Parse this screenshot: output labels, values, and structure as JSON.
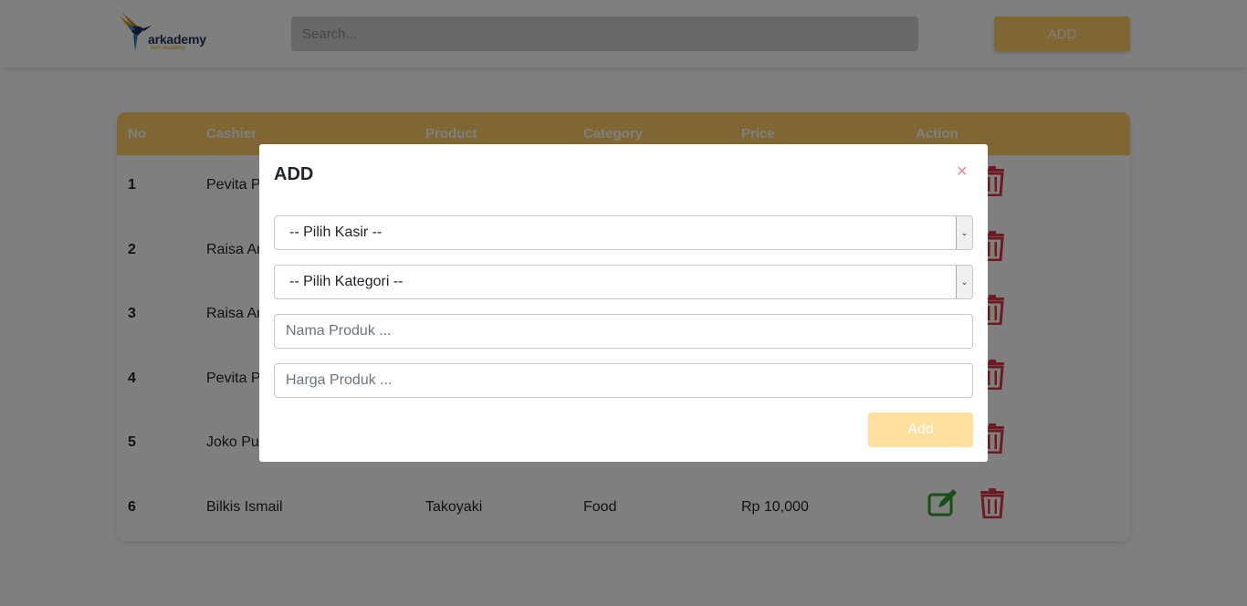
{
  "header": {
    "logo_text": "arkademy",
    "logo_subtext": "Tech Academy",
    "search_placeholder": "Search...",
    "add_label": "ADD"
  },
  "table": {
    "columns": [
      "No",
      "Cashier",
      "Product",
      "Category",
      "Price",
      "Action"
    ],
    "rows": [
      {
        "no": "1",
        "cashier": "Pevita Pe",
        "product": "",
        "category": "",
        "price": ""
      },
      {
        "no": "2",
        "cashier": "Raisa An",
        "product": "",
        "category": "",
        "price": ""
      },
      {
        "no": "3",
        "cashier": "Raisa An",
        "product": "",
        "category": "",
        "price": ""
      },
      {
        "no": "4",
        "cashier": "Pevita Pe",
        "product": "",
        "category": "",
        "price": ""
      },
      {
        "no": "5",
        "cashier": "Joko Pur",
        "product": "",
        "category": "",
        "price": ""
      },
      {
        "no": "6",
        "cashier": "Bilkis Ismail",
        "product": "Takoyaki",
        "category": "Food",
        "price": "Rp 10,000"
      }
    ]
  },
  "modal": {
    "title": "ADD",
    "close_symbol": "×",
    "cashier_select": "-- Pilih Kasir --",
    "category_select": "-- Pilih Kategori --",
    "product_name_placeholder": "Nama Produk ...",
    "product_price_placeholder": "Harga Produk ...",
    "submit_label": "Add"
  },
  "colors": {
    "accent": "#ffcc66",
    "edit": "#2e9e2e",
    "delete": "#dc3545"
  },
  "icons": {
    "edit": "edit-icon",
    "delete": "trash-icon",
    "logo": "hummingbird-logo"
  }
}
